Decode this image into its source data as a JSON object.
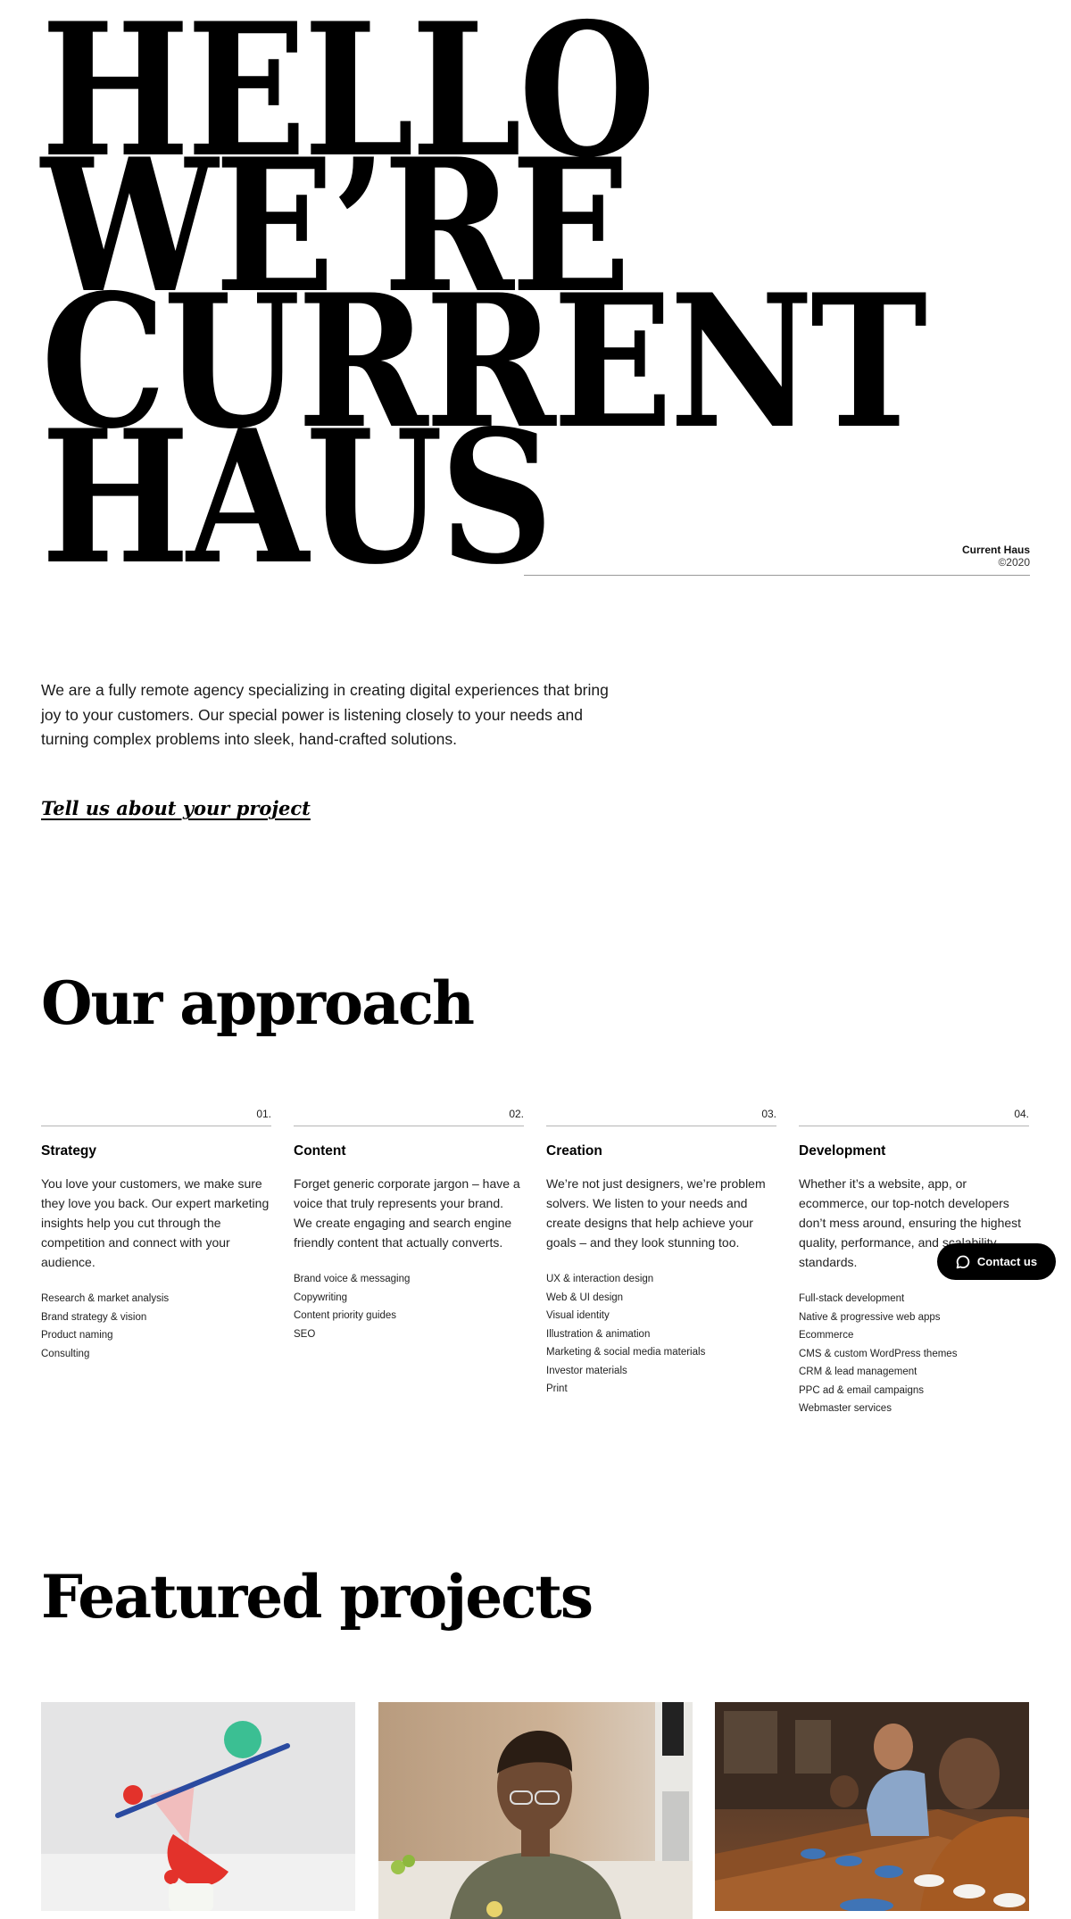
{
  "hero": {
    "lines": [
      "HELLO",
      "WE’RE",
      "CURRENT",
      "HAUS"
    ],
    "credit_name": "Current Haus",
    "credit_year": "©2020"
  },
  "intro": {
    "text": "We are a fully remote agency specializing in creating digital experiences that bring joy to your customers. Our special power is listening closely to your needs and turning complex problems into sleek, hand-crafted solutions.",
    "cta": "Tell us about your project"
  },
  "approach": {
    "title": "Our approach",
    "columns": [
      {
        "num": "01.",
        "title": "Strategy",
        "desc": "You love your customers, we make sure they love you back. Our expert marketing insights help you cut through the competition and connect with your audience.",
        "items": [
          "Research & market analysis",
          "Brand strategy & vision",
          "Product naming",
          "Consulting"
        ]
      },
      {
        "num": "02.",
        "title": "Content",
        "desc": "Forget generic corporate jargon – have a voice that truly represents your brand. We create engaging and search engine friendly content that actually converts.",
        "items": [
          "Brand voice & messaging",
          "Copywriting",
          "Content priority guides",
          "SEO"
        ]
      },
      {
        "num": "03.",
        "title": "Creation",
        "desc": "We’re not just designers, we’re problem solvers. We listen to your needs and create designs that help achieve your goals – and they look stunning too.",
        "items": [
          "UX & interaction design",
          "Web & UI design",
          "Visual identity",
          "Illustration & animation",
          "Marketing & social media materials",
          "Investor materials",
          "Print"
        ]
      },
      {
        "num": "04.",
        "title": "Development",
        "desc": "Whether it’s a website, app, or ecommerce, our top-notch developers don’t mess around, ensuring the highest quality, performance, and scalability standards.",
        "items": [
          "Full-stack development",
          "Native & progressive web apps",
          "Ecommerce",
          "CMS & custom WordPress themes",
          "CRM & lead management",
          "PPC ad & email campaigns",
          "Webmaster services"
        ]
      }
    ]
  },
  "contact": {
    "label": "Contact us",
    "icon": "chat-bubble-icon"
  },
  "featured": {
    "title": "Featured projects"
  },
  "colors": {
    "text": "#000000",
    "rule": "#b5b5b5",
    "button_bg": "#000000",
    "button_text": "#ffffff"
  }
}
